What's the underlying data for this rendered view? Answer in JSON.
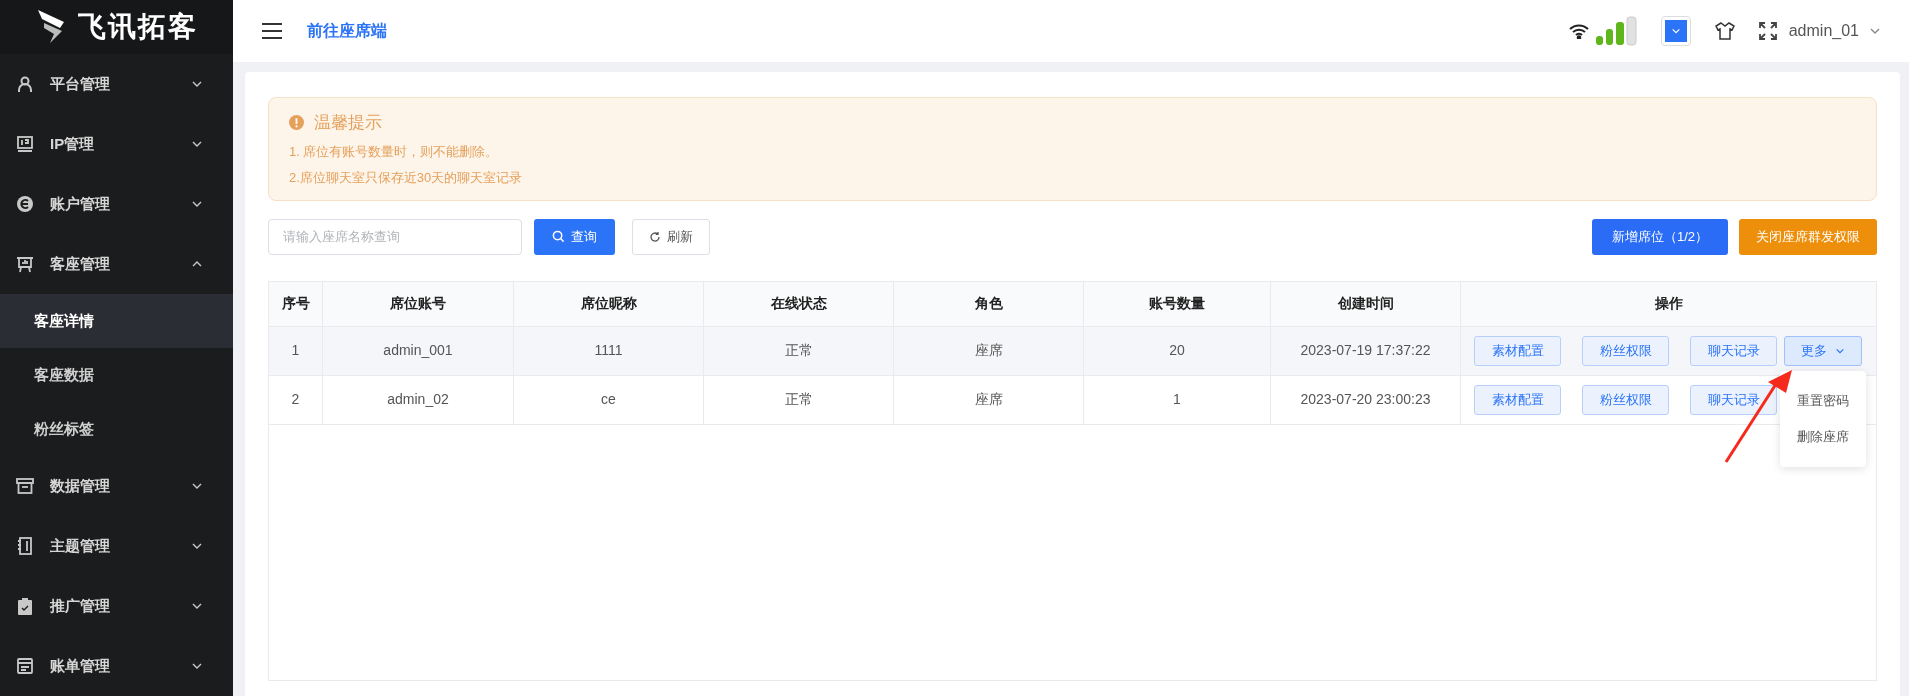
{
  "brand": {
    "name": "飞讯拓客"
  },
  "sidebar": {
    "items": [
      {
        "kind": "group",
        "label": "平台管理",
        "expanded": false,
        "selected": false
      },
      {
        "kind": "group",
        "label": "IP管理",
        "expanded": false,
        "selected": false
      },
      {
        "kind": "group",
        "label": "账户管理",
        "expanded": false,
        "selected": false
      },
      {
        "kind": "group",
        "label": "客座管理",
        "expanded": true,
        "selected": false
      },
      {
        "kind": "sub",
        "label": "客座详情",
        "selected": true
      },
      {
        "kind": "sub",
        "label": "客座数据",
        "selected": false
      },
      {
        "kind": "sub",
        "label": "粉丝标签",
        "selected": false
      },
      {
        "kind": "group",
        "label": "数据管理",
        "expanded": false,
        "selected": false
      },
      {
        "kind": "group",
        "label": "主题管理",
        "expanded": false,
        "selected": false
      },
      {
        "kind": "group",
        "label": "推广管理",
        "expanded": false,
        "selected": false
      },
      {
        "kind": "group",
        "label": "账单管理",
        "expanded": false,
        "selected": false
      }
    ]
  },
  "topbar": {
    "link": "前往座席端",
    "user": "admin_01"
  },
  "notice": {
    "title": "温馨提示",
    "lines": [
      "1. 席位有账号数量时，则不能删除。",
      "2.席位聊天室只保存近30天的聊天室记录"
    ]
  },
  "search": {
    "placeholder": "请输入座席名称查询"
  },
  "buttons": {
    "query": "查询",
    "refresh": "刷新",
    "add": "新增席位（1/2）",
    "close_broadcast": "关闭座席群发权限"
  },
  "table": {
    "columns": [
      "序号",
      "席位账号",
      "席位昵称",
      "在线状态",
      "角色",
      "账号数量",
      "创建时间",
      "操作"
    ],
    "rows": [
      {
        "cells": [
          "1",
          "admin_001",
          "1111",
          "正常",
          "座席",
          "20",
          "2023-07-19 17:37:22"
        ],
        "highlighted": true,
        "actions": [
          "素材配置",
          "粉丝权限",
          "聊天记录"
        ],
        "more": "更多",
        "menu_open": true
      },
      {
        "cells": [
          "2",
          "admin_02",
          "ce",
          "正常",
          "座席",
          "1",
          "2023-07-20 23:00:23"
        ],
        "highlighted": false,
        "actions": [
          "素材配置",
          "粉丝权限",
          "聊天记录"
        ],
        "menu_open": false
      }
    ]
  },
  "more_menu": [
    "重置密码",
    "删除座席"
  ]
}
